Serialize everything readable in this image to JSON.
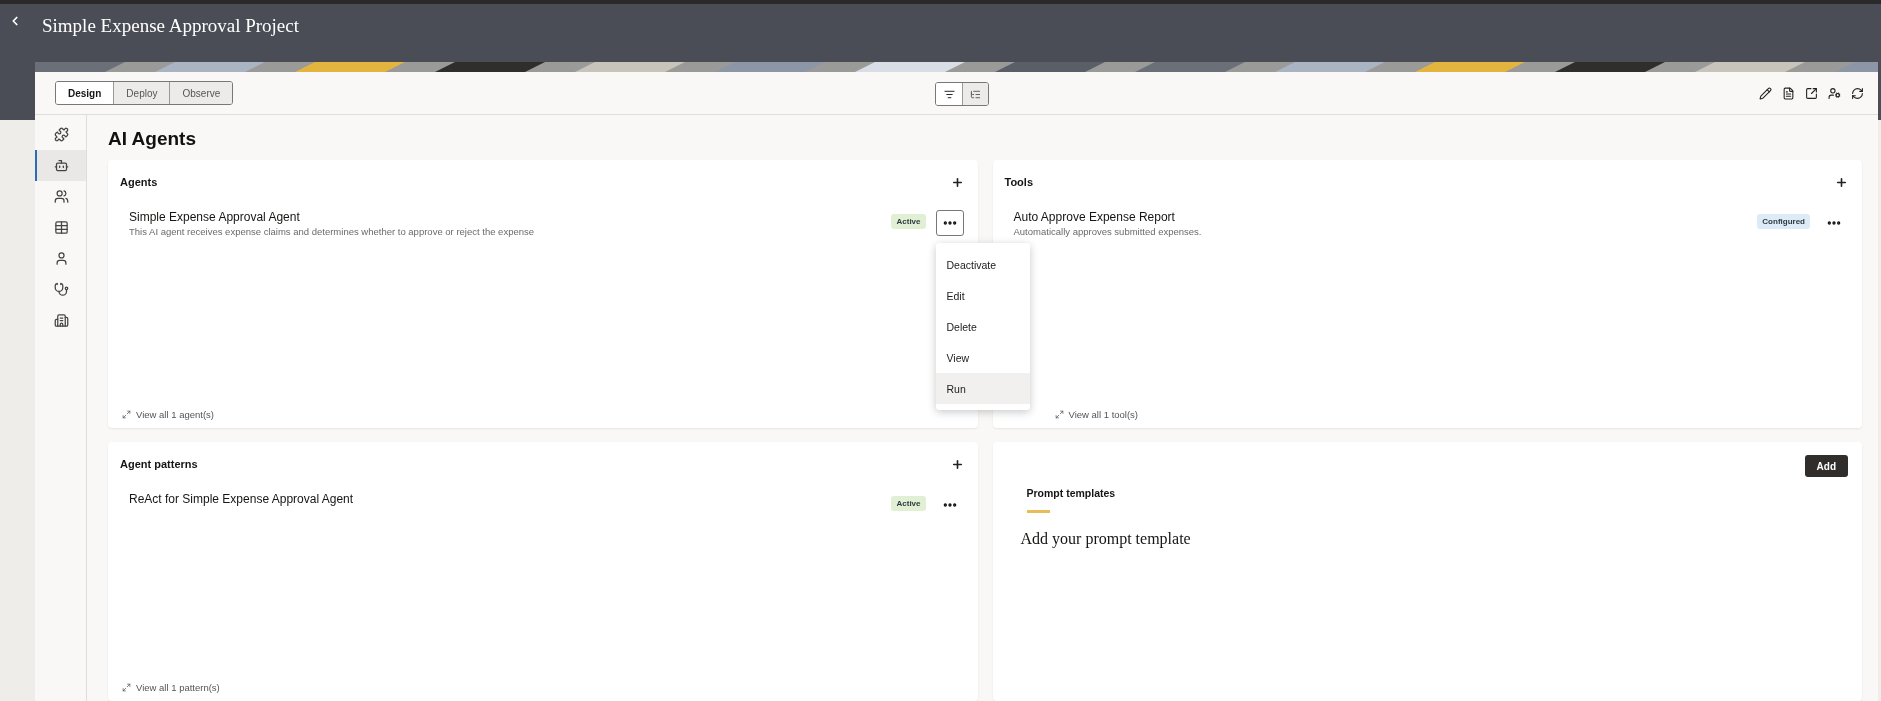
{
  "header": {
    "title": "Simple Expense Approval Project"
  },
  "mode_tabs": [
    {
      "label": "Design",
      "selected": true
    },
    {
      "label": "Deploy",
      "selected": false
    },
    {
      "label": "Observe",
      "selected": false
    }
  ],
  "view_toggle": [
    {
      "selected": true
    },
    {
      "selected": false
    }
  ],
  "sidebar": {
    "items": [
      {
        "selected": false
      },
      {
        "selected": true
      },
      {
        "selected": false
      },
      {
        "selected": false
      },
      {
        "selected": false
      },
      {
        "selected": false
      },
      {
        "selected": false
      }
    ]
  },
  "page_title": "AI Agents",
  "cards": [
    {
      "title": "Agents",
      "items": [
        {
          "name": "Simple Expense Approval Agent",
          "description": "This AI agent receives expense claims and determines whether to approve or reject the expense",
          "status": "Active",
          "color": "#e1f0d4",
          "menu": {
            "items": [
              {
                "label": "Deactivate",
                "selected": false
              },
              {
                "label": "Edit",
                "selected": false
              },
              {
                "label": "Delete",
                "selected": false
              },
              {
                "label": "View",
                "selected": false
              },
              {
                "label": "Run",
                "selected": true
              }
            ]
          }
        }
      ],
      "footer_link": "View all 1 agent(s)"
    },
    {
      "title": "Tools",
      "items": [
        {
          "name": "Auto Approve Expense Report",
          "description": "Automatically approves submitted expenses.",
          "status": "Configured",
          "color": "#dcebf7"
        }
      ],
      "footer_link": "View all 1 tool(s)"
    },
    {
      "title": "Agent patterns",
      "items": [
        {
          "name": "ReAct for Simple Expense Approval Agent",
          "status": "Active",
          "color": "#e1f0d4"
        }
      ],
      "footer_link": "View all 1 pattern(s)"
    }
  ],
  "prompts": {
    "button": "Add",
    "tabs": [
      {
        "label": "Prompt templates",
        "selected": true
      }
    ],
    "empty_text": "Add your prompt template"
  }
}
